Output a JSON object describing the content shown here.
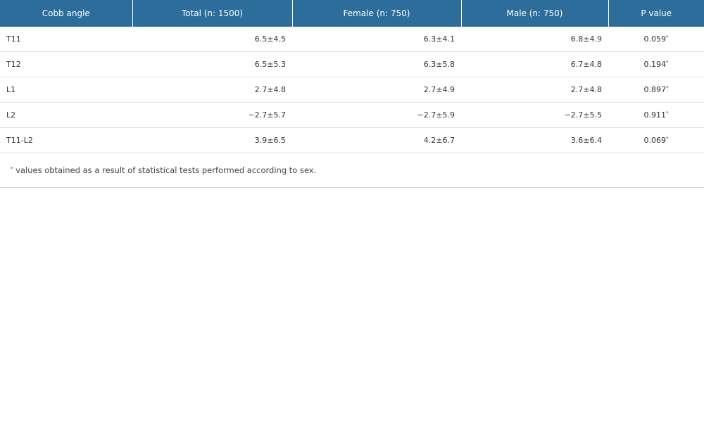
{
  "table": {
    "headers": [
      "Cobb angle",
      "Total (n: 1500)",
      "Female (n: 750)",
      "Male (n: 750)",
      "P value"
    ],
    "rows": [
      {
        "label": "T11",
        "total": "6.5±4.5",
        "female": "6.3±4.1",
        "male": "6.8±4.9",
        "p": "0.059",
        "mark": "*"
      },
      {
        "label": "T12",
        "total": "6.5±5.3",
        "female": "6.3±5.8",
        "male": "6.7±4.8",
        "p": "0.194",
        "mark": "*"
      },
      {
        "label": "L1",
        "total": "2.7±4.8",
        "female": "2.7±4.9",
        "male": "2.7±4.8",
        "p": "0.897",
        "mark": "*"
      },
      {
        "label": "L2",
        "total": "−2.7±5.7",
        "female": "−2.7±5.9",
        "male": "−2.7±5.5",
        "p": "0.911",
        "mark": "*"
      },
      {
        "label": "T11-L2",
        "total": "3.9±6.5",
        "female": "4.2±6.7",
        "male": "3.6±6.4",
        "p": "0.069",
        "mark": "*"
      }
    ]
  },
  "footnote": {
    "mark": "*",
    "text": " values obtained as a result of statistical tests performed according to sex."
  }
}
